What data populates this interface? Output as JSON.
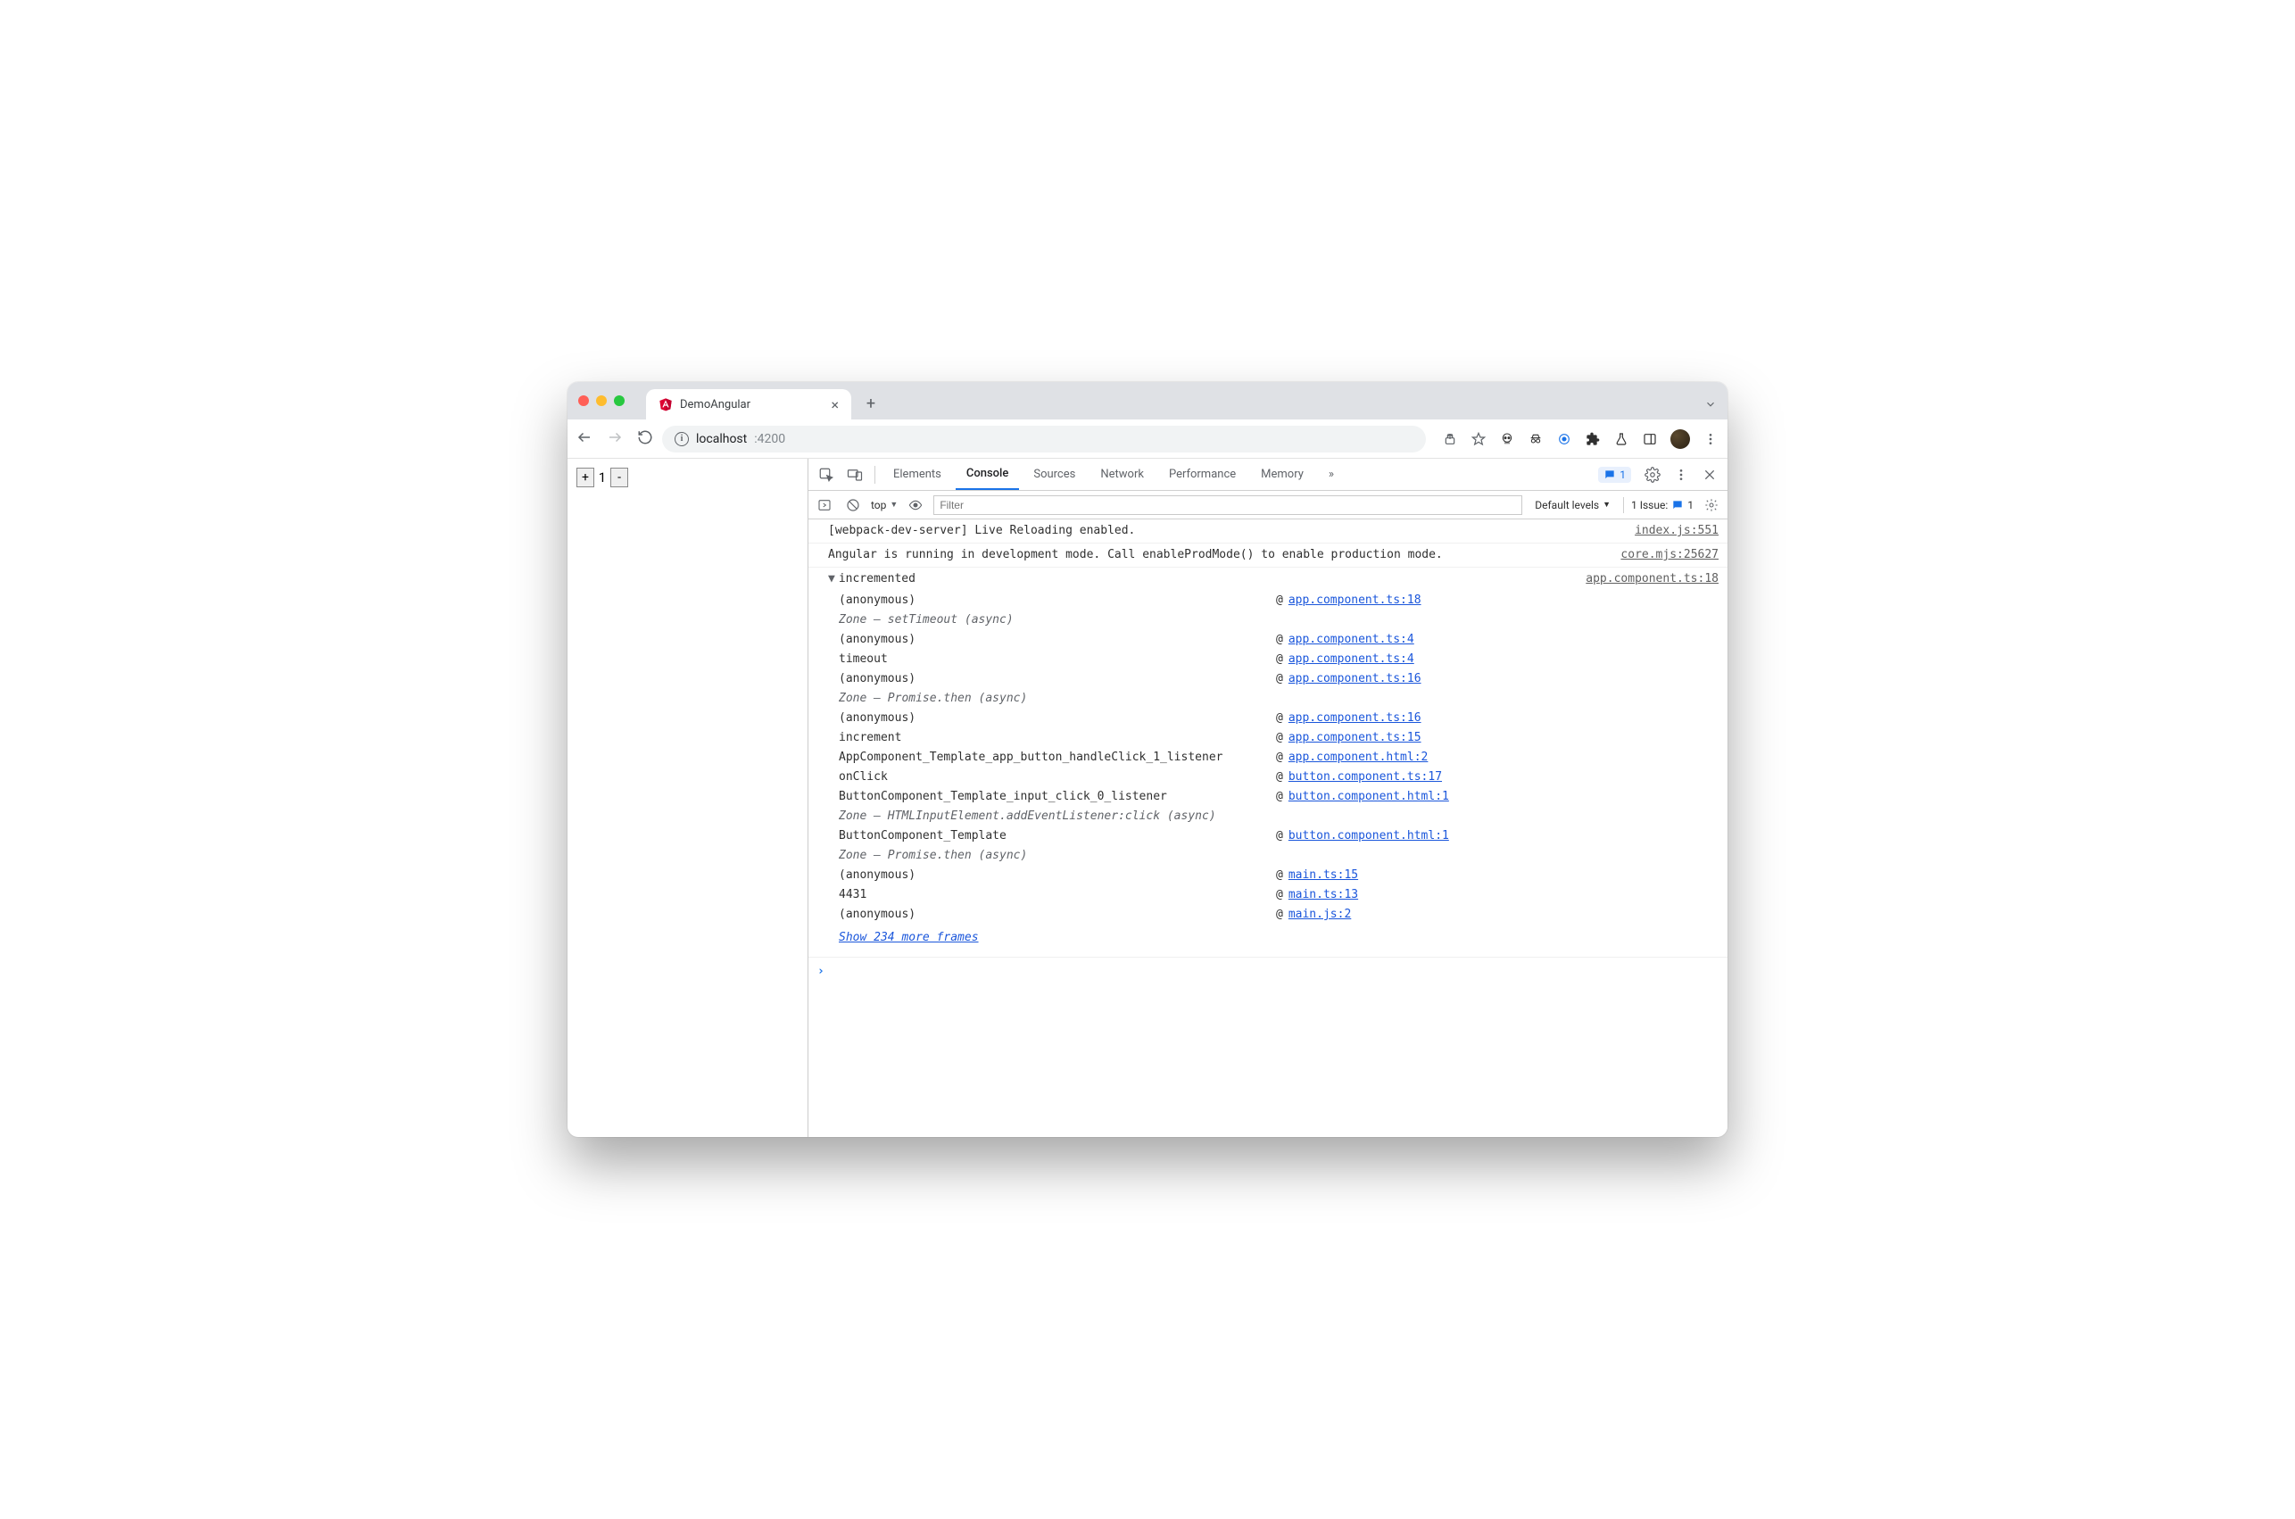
{
  "browser": {
    "tab_title": "DemoAngular",
    "url_host": "localhost",
    "url_port": ":4200"
  },
  "page": {
    "counter_value": "1",
    "inc": "+",
    "dec": "-"
  },
  "devtools": {
    "tabs": [
      "Elements",
      "Console",
      "Sources",
      "Network",
      "Performance",
      "Memory"
    ],
    "active_tab": "Console",
    "more_tabs_icon": "»",
    "messages_chip": "1",
    "toolbar": {
      "context": "top",
      "filter_placeholder": "Filter",
      "levels": "Default levels",
      "issues_label": "1 Issue:",
      "issues_count": "1"
    },
    "log": [
      {
        "msg": "[webpack-dev-server] Live Reloading enabled.",
        "src": "index.js:551"
      },
      {
        "msg": "Angular is running in development mode. Call enableProdMode() to enable production mode.",
        "src": "core.mjs:25627"
      }
    ],
    "trace": {
      "label": "incremented",
      "src": "app.component.ts:18",
      "frames": [
        {
          "fn": "(anonymous)",
          "link": "app.component.ts:18",
          "zone": false
        },
        {
          "fn": "Zone — setTimeout (async)",
          "link": "",
          "zone": true
        },
        {
          "fn": "(anonymous)",
          "link": "app.component.ts:4",
          "zone": false
        },
        {
          "fn": "timeout",
          "link": "app.component.ts:4",
          "zone": false
        },
        {
          "fn": "(anonymous)",
          "link": "app.component.ts:16",
          "zone": false
        },
        {
          "fn": "Zone — Promise.then (async)",
          "link": "",
          "zone": true
        },
        {
          "fn": "(anonymous)",
          "link": "app.component.ts:16",
          "zone": false
        },
        {
          "fn": "increment",
          "link": "app.component.ts:15",
          "zone": false
        },
        {
          "fn": "AppComponent_Template_app_button_handleClick_1_listener",
          "link": "app.component.html:2",
          "zone": false
        },
        {
          "fn": "onClick",
          "link": "button.component.ts:17",
          "zone": false
        },
        {
          "fn": "ButtonComponent_Template_input_click_0_listener",
          "link": "button.component.html:1",
          "zone": false
        },
        {
          "fn": "Zone — HTMLInputElement.addEventListener:click (async)",
          "link": "",
          "zone": true
        },
        {
          "fn": "ButtonComponent_Template",
          "link": "button.component.html:1",
          "zone": false
        },
        {
          "fn": "Zone — Promise.then (async)",
          "link": "",
          "zone": true
        },
        {
          "fn": "(anonymous)",
          "link": "main.ts:15",
          "zone": false
        },
        {
          "fn": "4431",
          "link": "main.ts:13",
          "zone": false
        },
        {
          "fn": "(anonymous)",
          "link": "main.js:2",
          "zone": false
        }
      ],
      "more": "Show 234 more frames"
    }
  }
}
